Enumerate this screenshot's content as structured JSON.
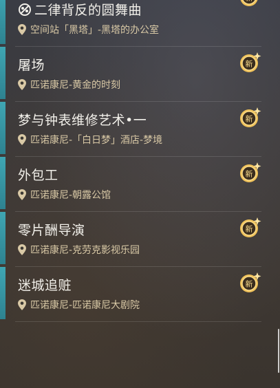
{
  "quests": [
    {
      "title": "二律背反的圆舞曲",
      "location": "空间站「黑塔」-黑塔的办公室",
      "badge": "新"
    },
    {
      "title": "屠场",
      "location": "匹诺康尼-黄金的时刻",
      "badge": "新"
    },
    {
      "title": "梦与钟表维修艺术•一",
      "location": "匹诺康尼-「白日梦」酒店-梦境",
      "badge": "新"
    },
    {
      "title": "外包工",
      "location": "匹诺康尼-朝露公馆",
      "badge": "新"
    },
    {
      "title": "零片酬导演",
      "location": "匹诺康尼-克劳克影视乐园",
      "badge": "新"
    },
    {
      "title": "迷城追赃",
      "location": "匹诺康尼-匹诺康尼大剧院",
      "badge": "新"
    }
  ],
  "colors": {
    "accent": "#3fa6b3",
    "title_text": "#f2f0ea",
    "location_text": "#d9c9a6",
    "badge_gold": "#e8b44a"
  },
  "icons": {
    "quest_type": "quest-type-icon",
    "location": "location-pin-icon",
    "new_badge": "new-badge-icon"
  }
}
